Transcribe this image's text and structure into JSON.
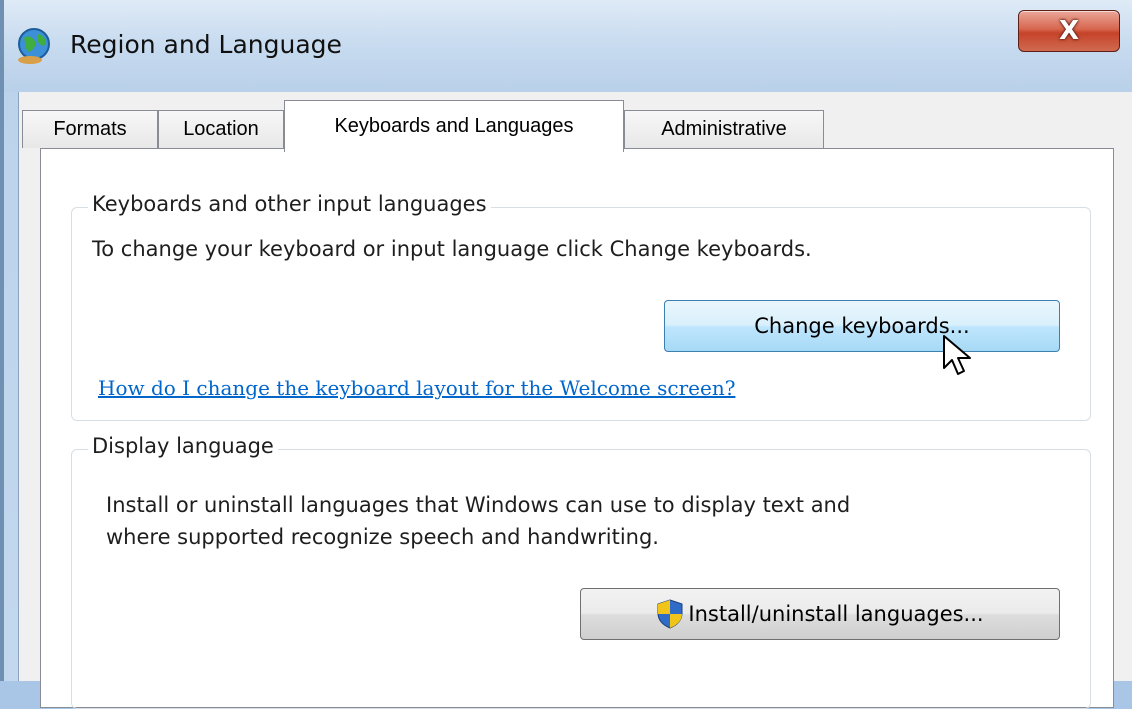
{
  "window": {
    "title": "Region and Language",
    "close_glyph": "X"
  },
  "tabs": [
    {
      "label": "Formats",
      "active": false
    },
    {
      "label": "Location",
      "active": false
    },
    {
      "label": "Keyboards and Languages",
      "active": true
    },
    {
      "label": "Administrative",
      "active": false
    }
  ],
  "keyboards_group": {
    "legend": "Keyboards and other input languages",
    "description": "To change your keyboard or input language click Change keyboards.",
    "button_label": "Change keyboards...",
    "link_text": "How do I change the keyboard layout for the Welcome screen?"
  },
  "display_group": {
    "legend": "Display language",
    "description_line1": "Install or uninstall languages that Windows can use to display text and",
    "description_line2": "where supported recognize speech and handwriting.",
    "button_label": "Install/uninstall languages..."
  },
  "icons": {
    "app": "globe-icon",
    "close": "close-icon",
    "shield": "uac-shield-icon",
    "cursor": "mouse-pointer-icon"
  }
}
